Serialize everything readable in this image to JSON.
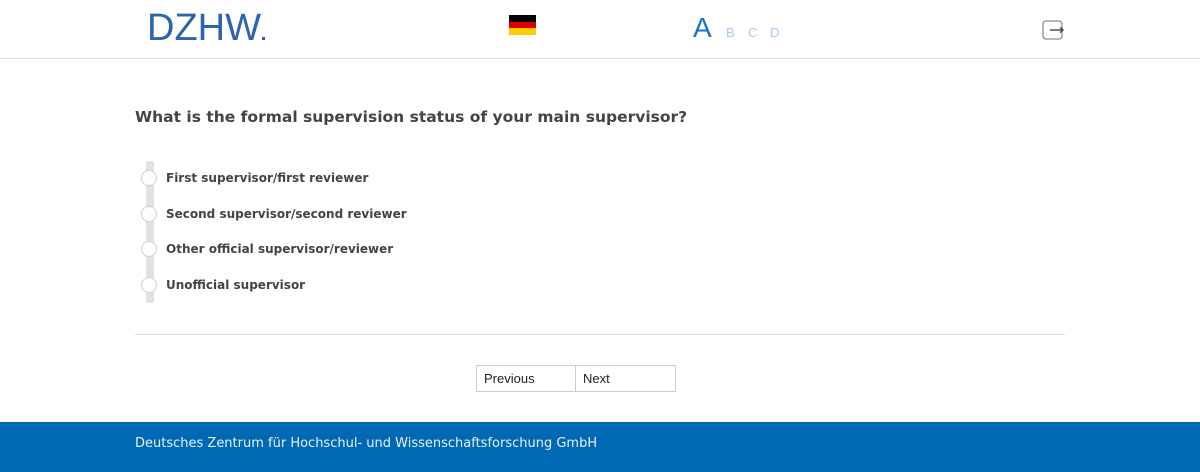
{
  "header": {
    "logo_text": "DZHW",
    "flag_name": "german-flag-icon",
    "font_size_options": [
      "A",
      "B",
      "C",
      "D"
    ],
    "exit_icon": "exit-icon"
  },
  "question": {
    "text": "What is the formal supervision status of your main supervisor?"
  },
  "options": [
    {
      "label": "First supervisor/first reviewer"
    },
    {
      "label": "Second supervisor/second reviewer"
    },
    {
      "label": "Other official supervisor/reviewer"
    },
    {
      "label": "Unofficial supervisor"
    }
  ],
  "navigation": {
    "previous_label": "Previous",
    "next_label": "Next"
  },
  "footer": {
    "text": "Deutsches Zentrum für Hochschul- und Wissenschaftsforschung GmbH"
  },
  "colors": {
    "brand_blue": "#0069b4",
    "logo_blue": "#2c64b0",
    "font_size_active": "#1a73c0",
    "font_size_inactive": "#a9cbe8"
  }
}
